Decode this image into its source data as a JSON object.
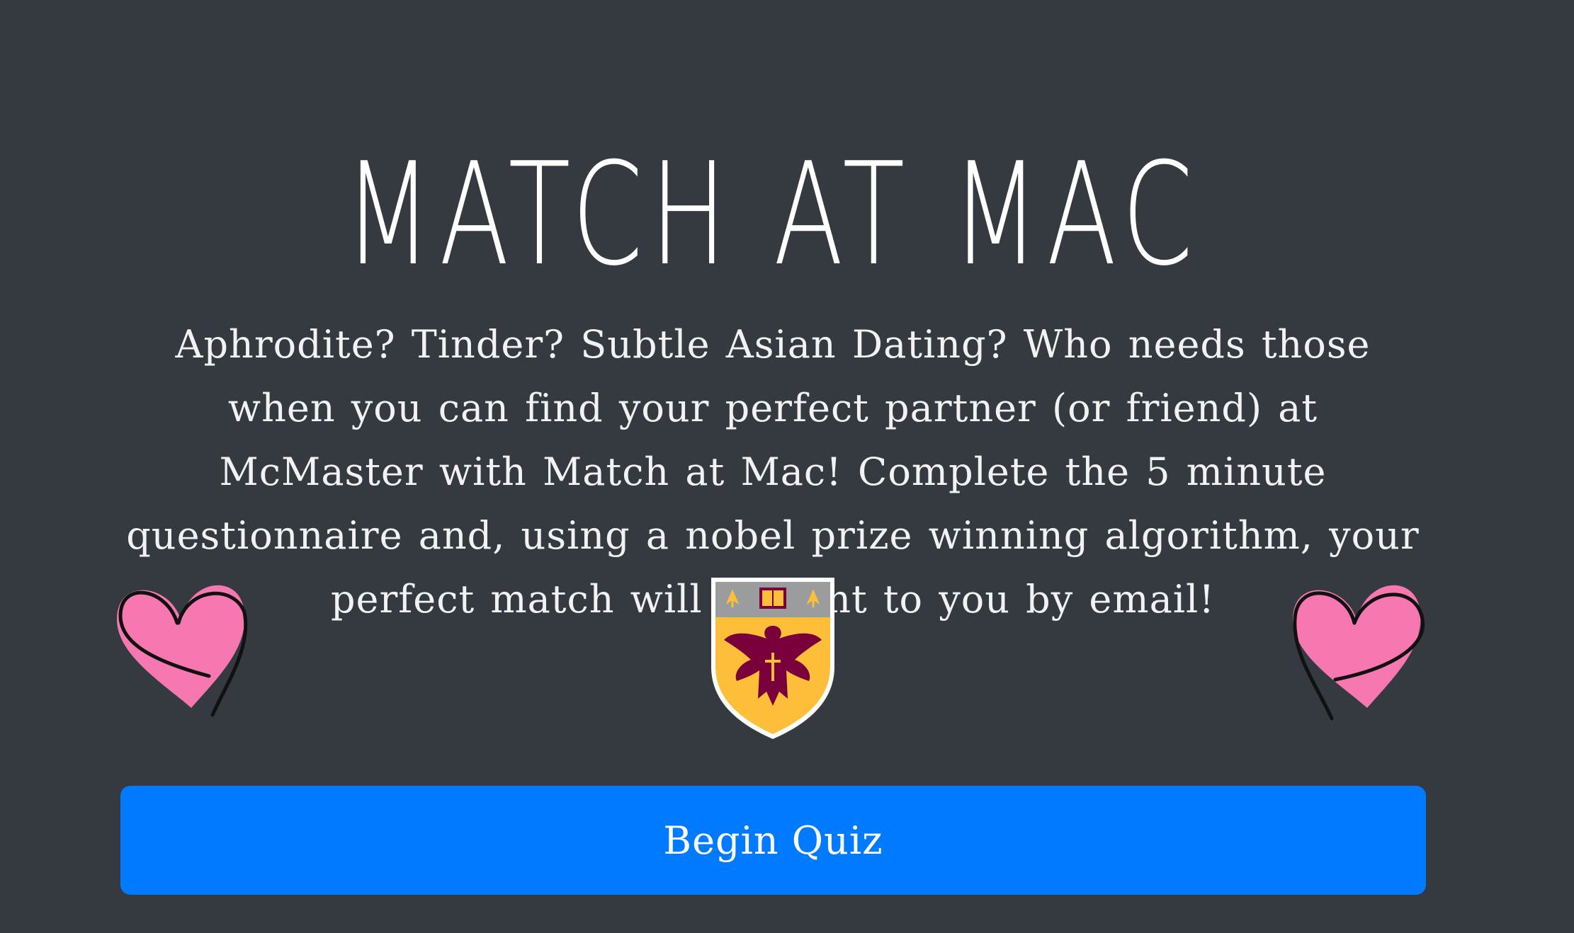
{
  "header": {
    "title": "MATCH AT MAC"
  },
  "intro": {
    "text": "Aphrodite? Tinder? Subtle Asian Dating? Who needs those when you can find your perfect partner (or friend) at McMaster with Match at Mac! Complete the 5 minute questionnaire and, using a nobel prize winning algorithm, your perfect match will be sent to you by email!"
  },
  "decorations": {
    "left_icon": "heart-icon",
    "right_icon": "heart-icon",
    "center_icon": "mcmaster-crest-icon"
  },
  "actions": {
    "begin_label": "Begin Quiz"
  },
  "colors": {
    "background": "#343a40",
    "accent": "#007bff",
    "heart": "#f778b0",
    "crest_gold": "#fdbf3a",
    "crest_maroon": "#7a003c"
  }
}
